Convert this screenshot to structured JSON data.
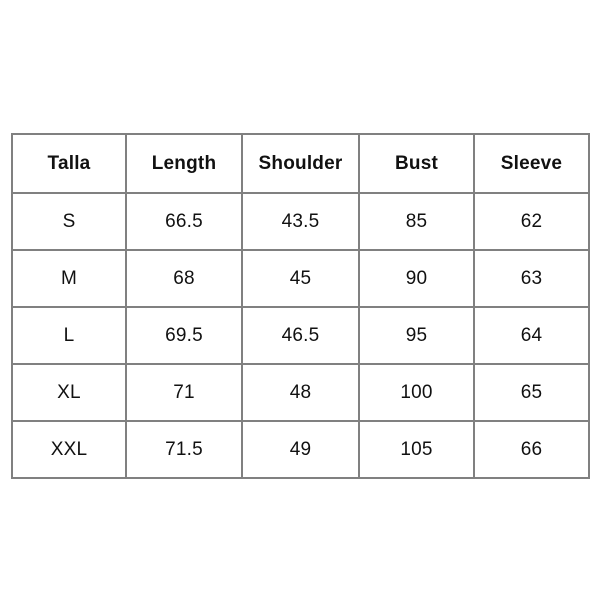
{
  "page": {
    "background_color": "#ffffff",
    "border_color": "#808080",
    "text_color": "#111111"
  },
  "chart_data": {
    "type": "table",
    "title": "",
    "columns": [
      "Talla",
      "Length",
      "Shoulder",
      "Bust",
      "Sleeve"
    ],
    "categories": [
      "S",
      "M",
      "L",
      "XL",
      "XXL"
    ],
    "series": [
      {
        "name": "Length",
        "values": [
          66.5,
          68,
          69.5,
          71,
          71.5
        ]
      },
      {
        "name": "Shoulder",
        "values": [
          43.5,
          45,
          46.5,
          48,
          49
        ]
      },
      {
        "name": "Bust",
        "values": [
          85,
          90,
          95,
          100,
          105
        ]
      },
      {
        "name": "Sleeve",
        "values": [
          62,
          63,
          64,
          65,
          66
        ]
      }
    ]
  },
  "table": {
    "headers": [
      "Talla",
      "Length",
      "Shoulder",
      "Bust",
      "Sleeve"
    ],
    "rows": [
      {
        "size": "S",
        "length": "66.5",
        "shoulder": "43.5",
        "bust": "85",
        "sleeve": "62"
      },
      {
        "size": "M",
        "length": "68",
        "shoulder": "45",
        "bust": "90",
        "sleeve": "63"
      },
      {
        "size": "L",
        "length": "69.5",
        "shoulder": "46.5",
        "bust": "95",
        "sleeve": "64"
      },
      {
        "size": "XL",
        "length": "71",
        "shoulder": "48",
        "bust": "100",
        "sleeve": "65"
      },
      {
        "size": "XXL",
        "length": "71.5",
        "shoulder": "49",
        "bust": "105",
        "sleeve": "66"
      }
    ]
  }
}
